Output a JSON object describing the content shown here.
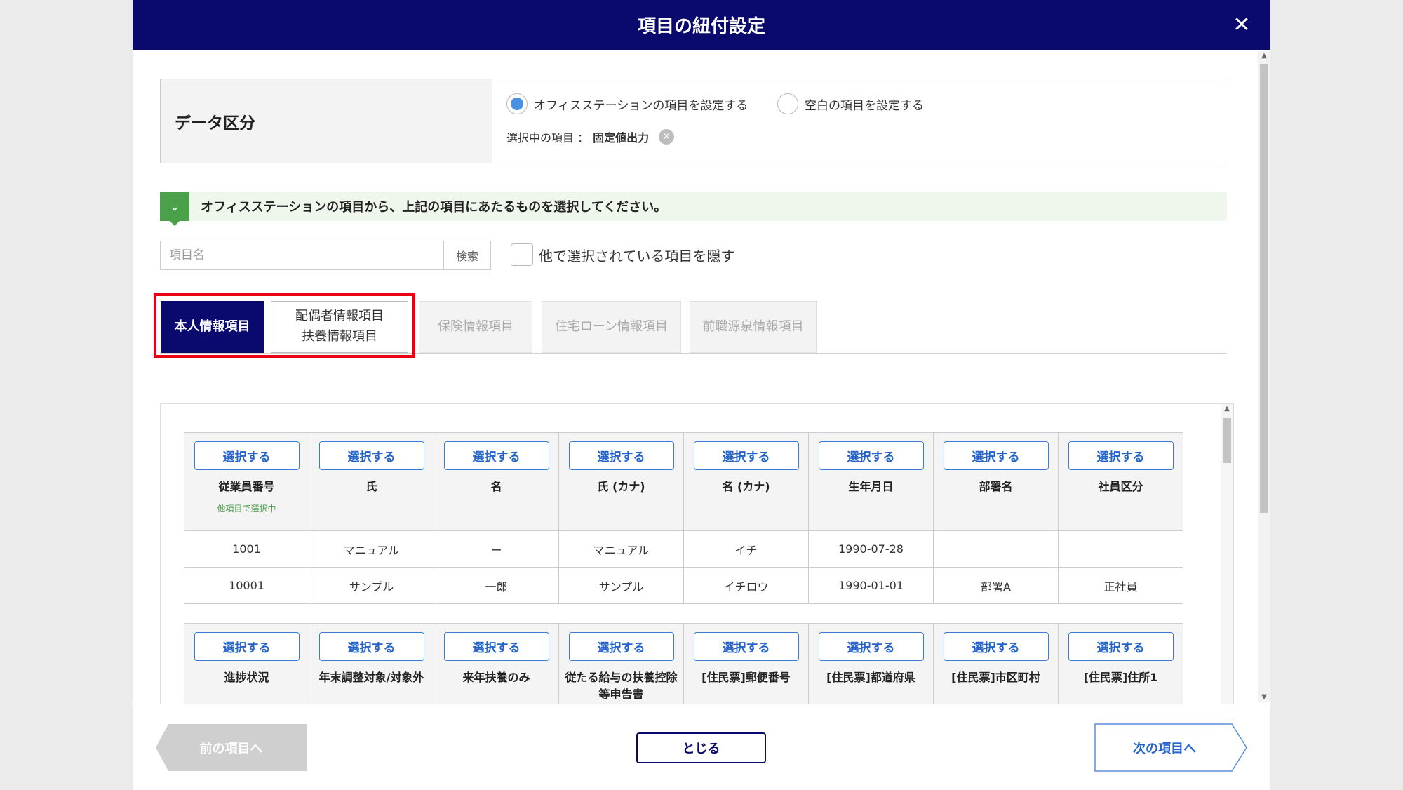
{
  "modal": {
    "title": "項目の紐付設定"
  },
  "data_category": {
    "label": "データ区分",
    "options": [
      {
        "label": "オフィスステーションの項目を設定する",
        "selected": true
      },
      {
        "label": "空白の項目を設定する",
        "selected": false
      }
    ],
    "selected_prefix": "選択中の項目 ：",
    "selected_value": "固定値出力"
  },
  "notice": {
    "text": "オフィスステーションの項目から、上記の項目にあたるものを選択してください。"
  },
  "search": {
    "placeholder": "項目名",
    "button_label": "検索",
    "hide_checkbox_label": "他で選択されている項目を隠す"
  },
  "tabs": [
    {
      "label": "本人情報項目",
      "state": "active"
    },
    {
      "label_line1": "配偶者情報項目",
      "label_line2": "扶養情報項目",
      "state": "normal"
    },
    {
      "label": "保険情報項目",
      "state": "disabled"
    },
    {
      "label": "住宅ローン情報項目",
      "state": "disabled"
    },
    {
      "label": "前職源泉情報項目",
      "state": "disabled"
    }
  ],
  "table": {
    "select_label": "選択する",
    "note_label": "他項目で選択中",
    "block1": {
      "columns": [
        "従業員番号",
        "氏",
        "名",
        "氏 (カナ)",
        "名 (カナ)",
        "生年月日",
        "部署名",
        "社員区分"
      ],
      "rows": [
        [
          "1001",
          "マニュアル",
          "ー",
          "マニュアル",
          "イチ",
          "1990-07-28",
          "",
          ""
        ],
        [
          "10001",
          "サンプル",
          "一郎",
          "サンプル",
          "イチロウ",
          "1990-01-01",
          "部署A",
          "正社員"
        ]
      ]
    },
    "block2": {
      "columns": [
        "進捗状況",
        "年末調整対象/対象外",
        "来年扶養のみ",
        "従たる給与の扶養控除等申告書",
        "[住民票]郵便番号",
        "[住民票]都道府県",
        "[住民票]市区町村",
        "[住民票]住所1"
      ]
    }
  },
  "footer": {
    "prev_label": "前の項目へ",
    "close_label": "とじる",
    "next_label": "次の項目へ"
  }
}
